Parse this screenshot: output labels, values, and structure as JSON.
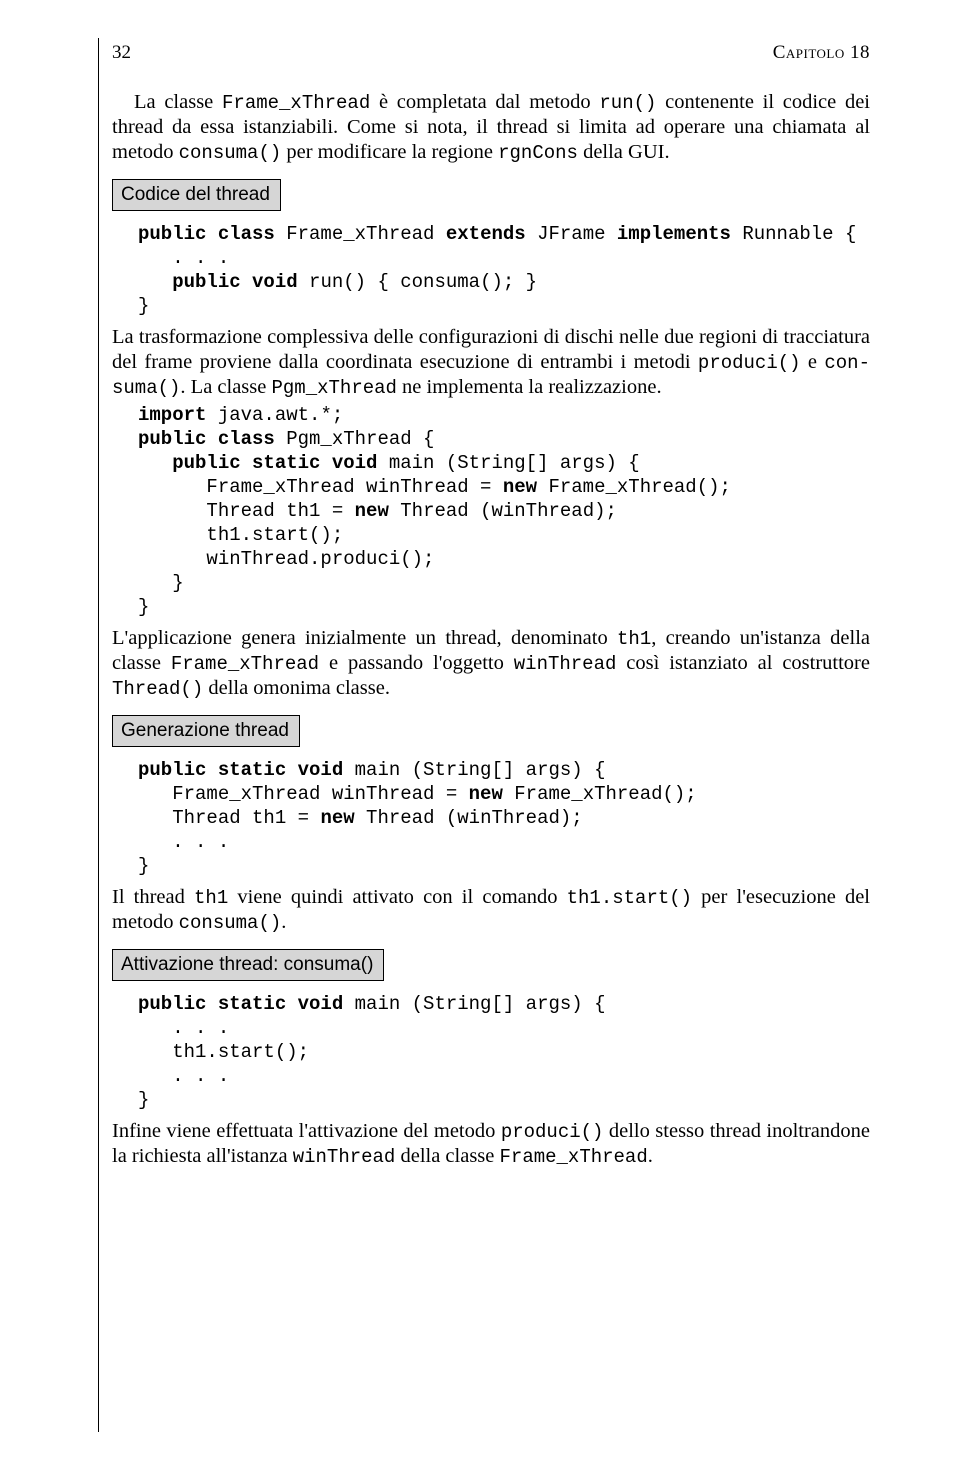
{
  "header": {
    "page_number": "32",
    "chapter": "Capitolo 18"
  },
  "p1a": "La classe ",
  "p1b": "Frame_xThread",
  "p1c": " è completata dal metodo ",
  "p1d": "run()",
  "p1e": " contenente il codice dei thread da essa istanziabili. Come si nota, il thread si limita ad operare una chiamata al metodo ",
  "p1f": "consuma()",
  "p1g": " per modificare la regione ",
  "p1h": "rgnCons",
  "p1i": " della GUI.",
  "label1": "Codice del thread",
  "code1": "public class Frame_xThread extends JFrame implements Runnable {\n   . . .\n   public void run() { consuma(); }\n}",
  "p2a": "La trasformazione complessiva delle configurazioni di dischi nelle due regioni di tracciatura del frame proviene dalla coordinata esecuzione di entrambi i metodi ",
  "p2b": "produci()",
  "p2c": " e ",
  "p2d": "con-suma()",
  "p2e": ". La classe ",
  "p2f": "Pgm_xThread",
  "p2g": " ne implementa la realizzazione.",
  "code2": "import java.awt.*;\npublic class Pgm_xThread {\n   public static void main (String[] args) {\n      Frame_xThread winThread = new Frame_xThread();\n      Thread th1 = new Thread (winThread);\n      th1.start();\n      winThread.produci();\n   }\n}",
  "p3a": "L'applicazione genera inizialmente un thread, denominato ",
  "p3b": "th1",
  "p3c": ", creando un'istanza della classe ",
  "p3d": "Frame_xThread",
  "p3e": " e passando l'oggetto ",
  "p3f": "winThread",
  "p3g": " così istanziato al costruttore ",
  "p3h": "Thread()",
  "p3i": " della omonima classe.",
  "label2": "Generazione thread",
  "code3": "public static void main (String[] args) {\n   Frame_xThread winThread = new Frame_xThread();\n   Thread th1 = new Thread (winThread);\n   . . .\n}",
  "p4a": "Il thread ",
  "p4b": "th1",
  "p4c": " viene quindi attivato con il comando ",
  "p4d": "th1.start()",
  "p4e": " per l'esecuzione del metodo ",
  "p4f": "consuma()",
  "p4g": ".",
  "label3": "Attivazione thread: consuma()",
  "code4": "public static void main (String[] args) {\n   . . .\n   th1.start();\n   . . .\n}",
  "p5a": "Infine viene effettuata l'attivazione del metodo ",
  "p5b": "produci()",
  "p5c": " dello stesso thread inoltrandone la richiesta all'istanza ",
  "p5d": "winThread",
  "p5e": " della classe ",
  "p5f": "Frame_xThread",
  "p5g": "."
}
